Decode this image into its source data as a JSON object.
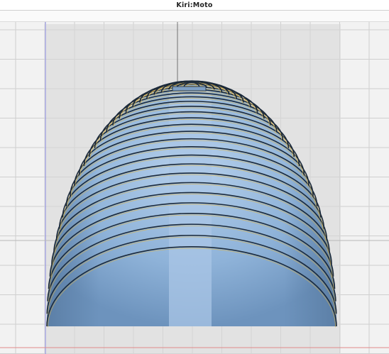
{
  "app": {
    "title": "Kiri:Moto"
  },
  "colors": {
    "grid_background": "#f2f2f2",
    "grid_line": "#cfcfcf",
    "grid_major": "#c4c4c4",
    "bed_region": "#e2e2e2",
    "x_axis": "#e08a8a",
    "y_axis": "#8a8ae0",
    "part_fill": "#8fb3d9",
    "part_core": "#a9c6e6",
    "slice_outline": "#1c2a3a",
    "slice_highlight": "#d8b24a"
  },
  "viewport": {
    "view": "front",
    "object": "dome-slices"
  }
}
